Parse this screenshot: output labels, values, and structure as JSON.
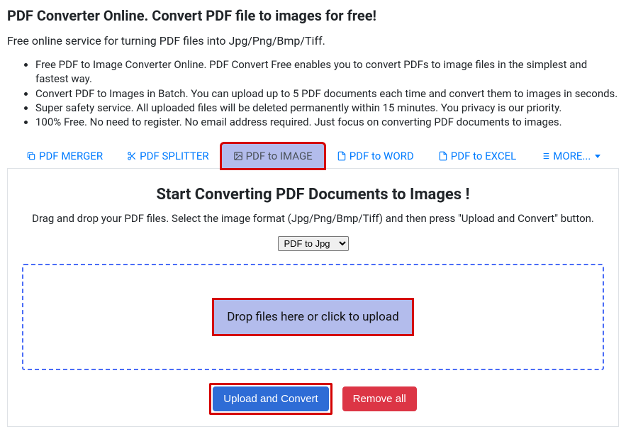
{
  "title": "PDF Converter Online. Convert PDF file to images for free!",
  "subtitle": "Free online service for turning PDF files into Jpg/Png/Bmp/Tiff.",
  "features": [
    "Free PDF to Image Converter Online. PDF Convert Free enables you to convert PDFs to image files in the simplest and fastest way.",
    "Convert PDF to Images in Batch. You can upload up to 5 PDF documents each time and convert them to images in seconds.",
    "Super safety service. All uploaded files will be deleted permanently within 15 minutes. You privacy is our priority.",
    "100% Free. No need to register. No email address required. Just focus on converting PDF documents to images."
  ],
  "tabs": {
    "merger": "PDF MERGER",
    "splitter": "PDF SPLITTER",
    "image": "PDF to IMAGE",
    "word": "PDF to WORD",
    "excel": "PDF to EXCEL",
    "more": "MORE..."
  },
  "panel": {
    "heading": "Start Converting PDF Documents to Images !",
    "desc": "Drag and drop your PDF files. Select the image format (Jpg/Png/Bmp/Tiff) and then press \"Upload and Convert\" button.",
    "format_selected": "PDF to Jpg",
    "drop_text": "Drop files here or click to upload",
    "upload_button": "Upload and Convert",
    "remove_button": "Remove all"
  }
}
